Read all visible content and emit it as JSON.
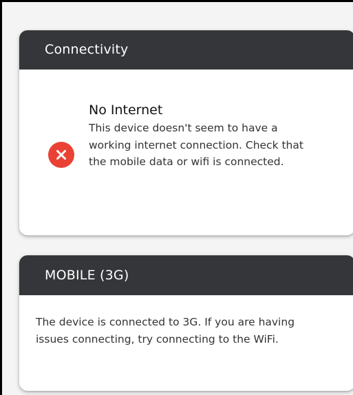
{
  "connectivity_card": {
    "title": "Connectivity",
    "status_title": "No Internet",
    "status_description": "This device doesn't seem to have a working internet connection. Check that the mobile data or wifi is connected.",
    "icon": "error-x-circle-icon",
    "icon_color": "#e94235"
  },
  "mobile_card": {
    "title": "MOBILE (3G)",
    "description": "The device is connected to 3G. If you are having issues connecting, try connecting to the WiFi."
  },
  "colors": {
    "header_bg": "#35363a",
    "error": "#e94235",
    "background": "#f4f4f4"
  }
}
